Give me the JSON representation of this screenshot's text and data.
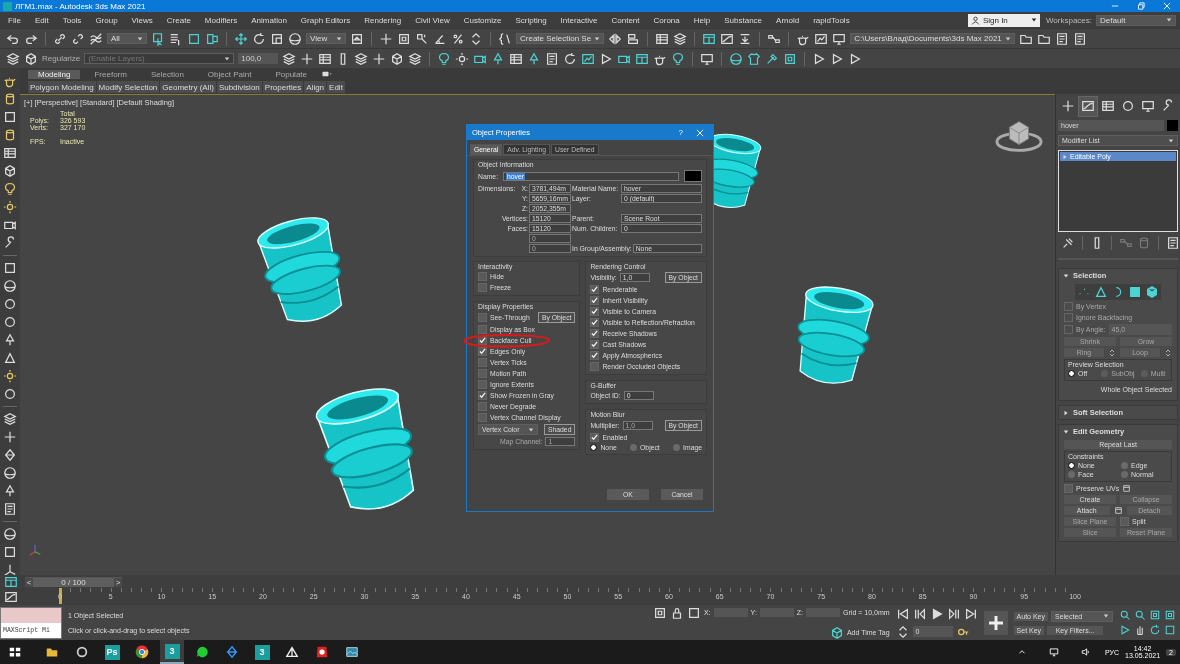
{
  "window": {
    "title": "ЛГМ1.max - Autodesk 3ds Max 2021"
  },
  "menu": [
    "File",
    "Edit",
    "Tools",
    "Group",
    "Views",
    "Create",
    "Modifiers",
    "Animation",
    "Graph Editors",
    "Rendering",
    "Civil View",
    "Customize",
    "Scripting",
    "Interactive",
    "Content",
    "Corona",
    "Help",
    "Substance",
    "Arnold",
    "rapidTools"
  ],
  "account": {
    "sign_in": "Sign In",
    "workspaces_label": "Workspaces:",
    "workspace": "Default"
  },
  "main_toolbar": {
    "selection_filter": "All",
    "reference_coordinate": "View",
    "named_selection": "Create Selection Se",
    "project_path": "C:\\Users\\Влад\\Documents\\3ds Max 2021"
  },
  "layer_toolbar": {
    "regularize": "Regularize",
    "layer": "(Enable Layers)",
    "value": "100,0"
  },
  "ribbon": {
    "tabs": [
      {
        "label": "Modeling",
        "selected": true
      },
      {
        "label": "Freeform",
        "selected": false
      },
      {
        "label": "Selection",
        "selected": false
      },
      {
        "label": "Object Paint",
        "selected": false
      },
      {
        "label": "Populate",
        "selected": false
      }
    ],
    "panels": [
      "Polygon Modeling",
      "Modify Selection",
      "Geometry (All)",
      "Subdivision",
      "Properties",
      "Align",
      "Edit"
    ]
  },
  "viewport": {
    "labels": [
      "[+]",
      "[Perspective]",
      "[Standard]",
      "[Default Shading]"
    ],
    "stats": {
      "total": "Total",
      "polys_label": "Polys:",
      "polys": "326 593",
      "verts_label": "Verts:",
      "verts": "327 170",
      "fps_label": "FPS:",
      "fps": "Inactive"
    }
  },
  "dialog": {
    "title": "Object Properties",
    "help": "?",
    "tabs": [
      {
        "label": "General",
        "selected": true
      },
      {
        "label": "Adv. Lighting",
        "selected": false
      },
      {
        "label": "User Defined",
        "selected": false
      }
    ],
    "info": {
      "title": "Object Information",
      "name_label": "Name:",
      "name": "hover",
      "dimensions_label": "Dimensions:",
      "rows": [
        {
          "label": "X:",
          "value": "3781,494m",
          "right_label": "Material Name:",
          "right_value": "hover"
        },
        {
          "label": "Y:",
          "value": "5659,16mm",
          "right_label": "Layer:",
          "right_value": "0 (default)"
        },
        {
          "label": "Z:",
          "value": "2052,355m"
        },
        {
          "label": "Vertices:",
          "value": "15120",
          "right_label": "Parent:",
          "right_value": "Scene Root"
        },
        {
          "label": "Faces:",
          "value": "15120",
          "right_label": "Num. Children:",
          "right_value": "0"
        },
        {
          "value": "0",
          "disabled": true
        },
        {
          "value": "0",
          "disabled": true,
          "right_label": "In Group/Assembly:",
          "right_value": "None"
        }
      ]
    },
    "interactivity": {
      "title": "Interactivity",
      "items": [
        {
          "label": "Hide",
          "checked": false
        },
        {
          "label": "Freeze",
          "checked": false
        }
      ]
    },
    "display": {
      "title": "Display Properties",
      "by_object": "By Object",
      "items": [
        {
          "label": "See-Through",
          "checked": false
        },
        {
          "label": "Display as Box",
          "checked": false
        },
        {
          "label": "Backface Cull",
          "checked": true
        },
        {
          "label": "Edges Only",
          "checked": true
        },
        {
          "label": "Vertex Ticks",
          "checked": false
        },
        {
          "label": "Motion Path",
          "checked": false
        },
        {
          "label": "Ignore Extents",
          "checked": false
        },
        {
          "label": "Show Frozen in Gray",
          "checked": true
        },
        {
          "label": "Never Degrade",
          "checked": false
        },
        {
          "label": "Vertex Channel Display",
          "checked": false
        }
      ],
      "color_mode": "Vertex Color",
      "shaded": "Shaded",
      "map_channel_label": "Map Channel:",
      "map_channel": "1"
    },
    "rendering": {
      "title": "Rendering Control",
      "visibility_label": "Visibility:",
      "visibility": "1,0",
      "by_object": "By Object",
      "items": [
        {
          "label": "Renderable",
          "checked": true
        },
        {
          "label": "Inherit Visibility",
          "checked": true
        },
        {
          "label": "Visible to Camera",
          "checked": true
        },
        {
          "label": "Visible to Reflection/Refraction",
          "checked": true
        },
        {
          "label": "Receive Shadows",
          "checked": true
        },
        {
          "label": "Cast Shadows",
          "checked": true
        },
        {
          "label": "Apply Atmospherics",
          "checked": true
        },
        {
          "label": "Render Occluded Objects",
          "checked": false
        }
      ]
    },
    "gbuffer": {
      "title": "G-Buffer",
      "object_id_label": "Object ID:",
      "object_id": "0"
    },
    "motion_blur": {
      "title": "Motion Blur",
      "multiplier_label": "Multiplier:",
      "multiplier": "1,0",
      "by_object": "By Object",
      "enabled": {
        "label": "Enabled",
        "checked": true
      },
      "modes": [
        {
          "label": "None",
          "selected": true
        },
        {
          "label": "Object",
          "selected": false
        },
        {
          "label": "Image",
          "selected": false
        }
      ]
    },
    "buttons": [
      "OK",
      "Cancel"
    ]
  },
  "command_panel": {
    "tabs": [
      {
        "selected": false
      },
      {
        "selected": true
      },
      {
        "selected": false
      },
      {
        "selected": false
      },
      {
        "selected": false
      },
      {
        "selected": false
      }
    ],
    "object_name": "hover",
    "modifier_list": "Modifier List",
    "stack": [
      {
        "label": "Editable Poly",
        "selected": true
      }
    ],
    "rollouts": [
      {
        "title": "Selection",
        "expanded": true,
        "items": [
          {
            "kind": "icons"
          },
          {
            "kind": "checkbox",
            "label": "By Vertex",
            "checked": false,
            "disabled": true
          },
          {
            "kind": "checkbox",
            "label": "Ignore Backfacing",
            "checked": false,
            "disabled": true
          },
          {
            "kind": "spinner",
            "label": "By Angle:",
            "value": "45,0",
            "checked": false,
            "disabled": true
          },
          {
            "kind": "row",
            "cells": [
              {
                "kind": "button",
                "label": "Shrink",
                "disabled": true
              },
              {
                "kind": "button",
                "label": "Grow",
                "disabled": true
              }
            ]
          },
          {
            "kind": "row",
            "cells": [
              {
                "kind": "button",
                "label": "Ring",
                "disabled": true,
                "stepper": true
              },
              {
                "kind": "button",
                "label": "Loop",
                "disabled": true,
                "stepper": true
              }
            ]
          },
          {
            "kind": "group",
            "title": "Preview Selection",
            "options": [
              {
                "label": "Off",
                "selected": true,
                "disabled": false
              },
              {
                "label": "SubObj",
                "selected": false,
                "disabled": true
              },
              {
                "label": "Multi",
                "selected": false,
                "disabled": true
              }
            ]
          },
          {
            "kind": "note",
            "text": "Whole Object Selected"
          }
        ]
      },
      {
        "title": "Soft Selection",
        "expanded": false
      },
      {
        "title": "Edit Geometry",
        "expanded": true,
        "items": [
          {
            "kind": "row",
            "cells": [
              {
                "kind": "button",
                "label": "Repeat Last",
                "disabled": false
              }
            ]
          },
          {
            "kind": "group",
            "title": "Constraints",
            "options": [
              {
                "label": "None",
                "selected": true,
                "disabled": false
              },
              {
                "label": "Edge",
                "selected": false,
                "disabled": false
              },
              {
                "label": "Face",
                "selected": false,
                "disabled": false
              },
              {
                "label": "Normal",
                "selected": false,
                "disabled": false
              }
            ]
          },
          {
            "kind": "checkbox",
            "label": "Preserve UVs",
            "checked": false,
            "disabled": false,
            "settings": true
          },
          {
            "kind": "row",
            "cells": [
              {
                "kind": "button",
                "label": "Create",
                "disabled": false
              },
              {
                "kind": "button",
                "label": "Collapse",
                "disabled": true
              }
            ]
          },
          {
            "kind": "row",
            "cells": [
              {
                "kind": "button",
                "label": "Attach",
                "disabled": false,
                "settings": true
              },
              {
                "kind": "button",
                "label": "Detach",
                "disabled": true
              }
            ]
          },
          {
            "kind": "row",
            "cells": [
              {
                "kind": "button",
                "label": "Slice Plane",
                "disabled": true
              },
              {
                "kind": "checkbox",
                "label": "Split",
                "checked": false
              }
            ]
          },
          {
            "kind": "row",
            "cells": [
              {
                "kind": "button",
                "label": "Slice",
                "disabled": true
              },
              {
                "kind": "button",
                "label": "Reset Plane",
                "disabled": true
              }
            ]
          }
        ]
      }
    ]
  },
  "timeline": {
    "prev": "<",
    "position": "0 / 100",
    "next": ">",
    "ticks": [
      "0",
      "5",
      "10",
      "15",
      "20",
      "25",
      "30",
      "35",
      "40",
      "45",
      "50",
      "55",
      "60",
      "65",
      "70",
      "75",
      "80",
      "85",
      "90",
      "95",
      "100"
    ]
  },
  "status": {
    "script_field": "MAXScript Mi",
    "selection": "1 Object Selected",
    "prompt": "Click or click-and-drag to select objects",
    "x_label": "X:",
    "y_label": "Y:",
    "z_label": "Z:",
    "grid": "Grid = 10,0mm",
    "time_tag": "Add Time Tag",
    "frame": "0",
    "auto_key": "Auto Key",
    "key_mode": "Selected",
    "set_key": "Set Key",
    "key_filters": "Key Filters..."
  },
  "taskbar": {
    "apps": [
      {
        "kind": "folder",
        "active": false
      },
      {
        "kind": "ring",
        "active": false
      },
      {
        "kind": "letters",
        "label": "Ps",
        "active": false
      },
      {
        "kind": "browser",
        "active": false
      },
      {
        "kind": "letters",
        "label": "3",
        "active": true
      },
      {
        "kind": "chat",
        "active": false
      },
      {
        "kind": "figure",
        "active": false
      },
      {
        "kind": "letters",
        "label": "3",
        "active": false
      },
      {
        "kind": "tent",
        "active": false
      },
      {
        "kind": "badge",
        "active": false
      },
      {
        "kind": "image",
        "active": false
      }
    ],
    "language": "РУС",
    "time": "14:42",
    "date": "13.05.2021",
    "notifications": "2"
  }
}
